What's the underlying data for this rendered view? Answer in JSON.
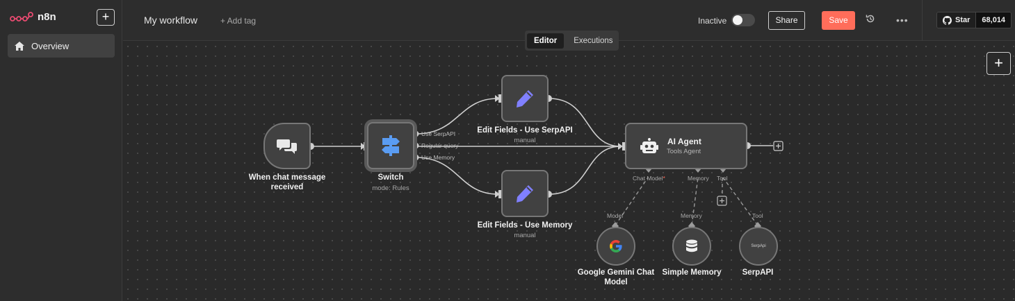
{
  "sidebar": {
    "brand": "n8n",
    "new_label": "+",
    "items": [
      {
        "label": "Overview",
        "icon": "home-icon"
      }
    ]
  },
  "header": {
    "workflow_name": "My workflow",
    "add_tag": "+ Add tag",
    "status": "Inactive",
    "share": "Share",
    "save": "Save",
    "more": "•••",
    "github": {
      "star_label": "Star",
      "count": "68,014"
    }
  },
  "tabs": [
    {
      "label": "Editor",
      "active": true
    },
    {
      "label": "Executions",
      "active": false
    }
  ],
  "canvas": {
    "add_label": "+"
  },
  "nodes": {
    "trigger": {
      "label_line1": "When chat message",
      "label_line2": "received"
    },
    "switch": {
      "label": "Switch",
      "subtitle": "mode: Rules",
      "outputs": [
        "Use SerpAPI",
        "Regular query",
        "Use Memory"
      ]
    },
    "edit_serp": {
      "label": "Edit Fields - Use SerpAPI",
      "subtitle": "manual"
    },
    "edit_memory": {
      "label": "Edit Fields - Use Memory",
      "subtitle": "manual"
    },
    "agent": {
      "title": "AI Agent",
      "subtitle": "Tools Agent",
      "inputs": [
        "Chat Model",
        "Memory",
        "Tool"
      ],
      "required_mark": "*"
    },
    "gemini": {
      "label_line1": "Google Gemini Chat",
      "label_line2": "Model",
      "port": "Model"
    },
    "memory": {
      "label": "Simple Memory",
      "port": "Memory"
    },
    "serpapi": {
      "label": "SerpAPI",
      "port": "Tool",
      "icon_text": "SerpApi"
    }
  },
  "colors": {
    "accent": "#ff6d5a",
    "pencil": "#7f7fff",
    "switch": "#5a9cf2",
    "logo": "#ea4b71"
  }
}
